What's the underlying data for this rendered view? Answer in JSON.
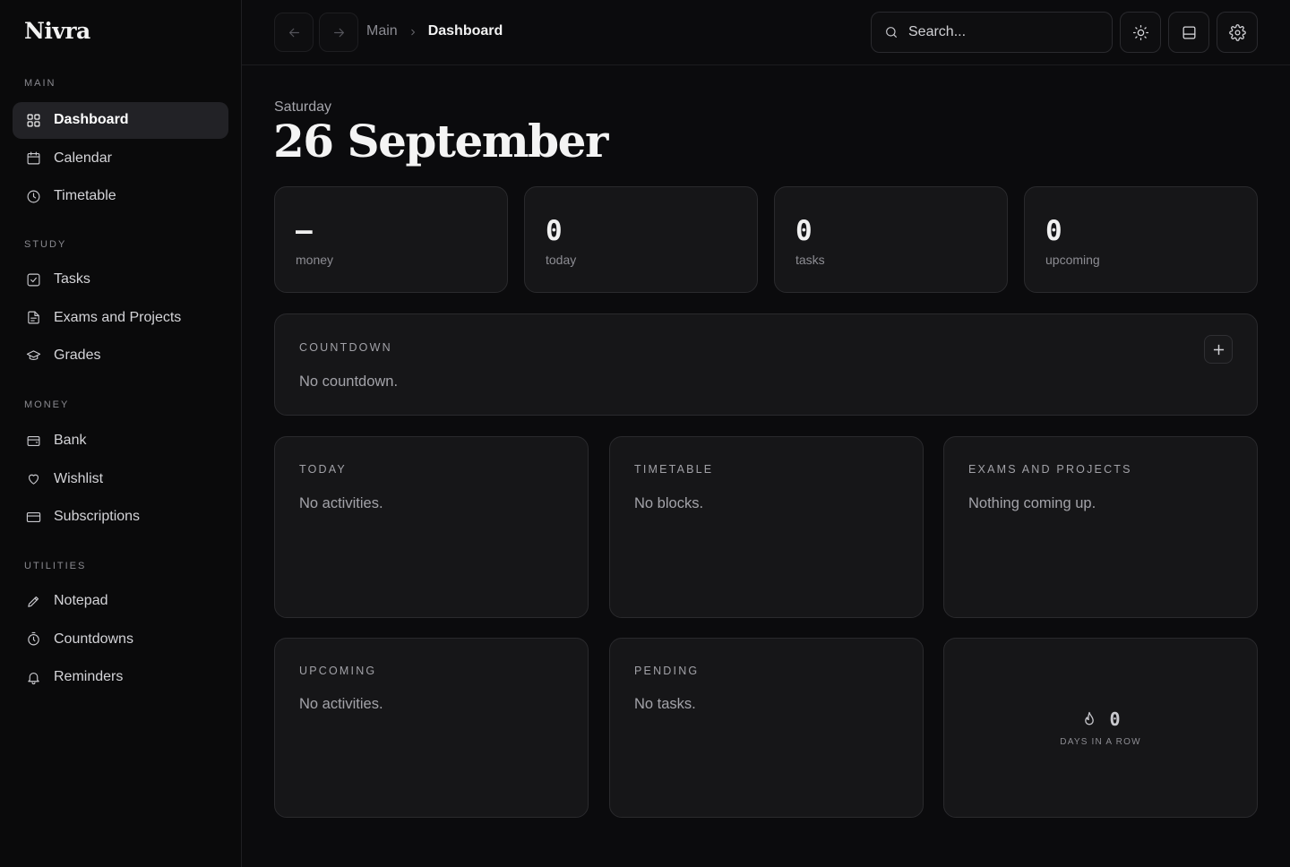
{
  "app": {
    "name": "Nivra"
  },
  "sidebar": {
    "sections": [
      {
        "label": "MAIN",
        "items": [
          {
            "label": "Dashboard",
            "icon": "grid-icon",
            "active": true
          },
          {
            "label": "Calendar",
            "icon": "calendar-icon"
          },
          {
            "label": "Timetable",
            "icon": "clock-icon"
          }
        ]
      },
      {
        "label": "STUDY",
        "items": [
          {
            "label": "Tasks",
            "icon": "checkbox-icon"
          },
          {
            "label": "Exams and Projects",
            "icon": "document-icon"
          },
          {
            "label": "Grades",
            "icon": "graduation-cap-icon"
          }
        ]
      },
      {
        "label": "MONEY",
        "items": [
          {
            "label": "Bank",
            "icon": "wallet-icon"
          },
          {
            "label": "Wishlist",
            "icon": "heart-icon"
          },
          {
            "label": "Subscriptions",
            "icon": "credit-card-icon"
          }
        ]
      },
      {
        "label": "UTILITIES",
        "items": [
          {
            "label": "Notepad",
            "icon": "pencil-icon"
          },
          {
            "label": "Countdowns",
            "icon": "stopwatch-icon"
          },
          {
            "label": "Reminders",
            "icon": "bell-icon"
          }
        ]
      }
    ]
  },
  "topbar": {
    "breadcrumb": {
      "parent": "Main",
      "current": "Dashboard"
    },
    "search": {
      "placeholder": "Search..."
    }
  },
  "date": {
    "weekday": "Saturday",
    "date": "26 September"
  },
  "stats": [
    {
      "value": "–",
      "label": "money"
    },
    {
      "value": "0",
      "label": "today"
    },
    {
      "value": "0",
      "label": "tasks"
    },
    {
      "value": "0",
      "label": "upcoming"
    }
  ],
  "countdown": {
    "title": "COUNTDOWN",
    "empty": "No countdown."
  },
  "panels": {
    "today": {
      "title": "TODAY",
      "empty": "No activities."
    },
    "timetable": {
      "title": "TIMETABLE",
      "empty": "No blocks."
    },
    "exams": {
      "title": "EXAMS AND PROJECTS",
      "empty": "Nothing coming up."
    },
    "upcoming": {
      "title": "UPCOMING",
      "empty": "No activities."
    },
    "pending": {
      "title": "PENDING",
      "empty": "No tasks."
    }
  },
  "streak": {
    "value": "0",
    "label": "DAYS IN A ROW"
  }
}
